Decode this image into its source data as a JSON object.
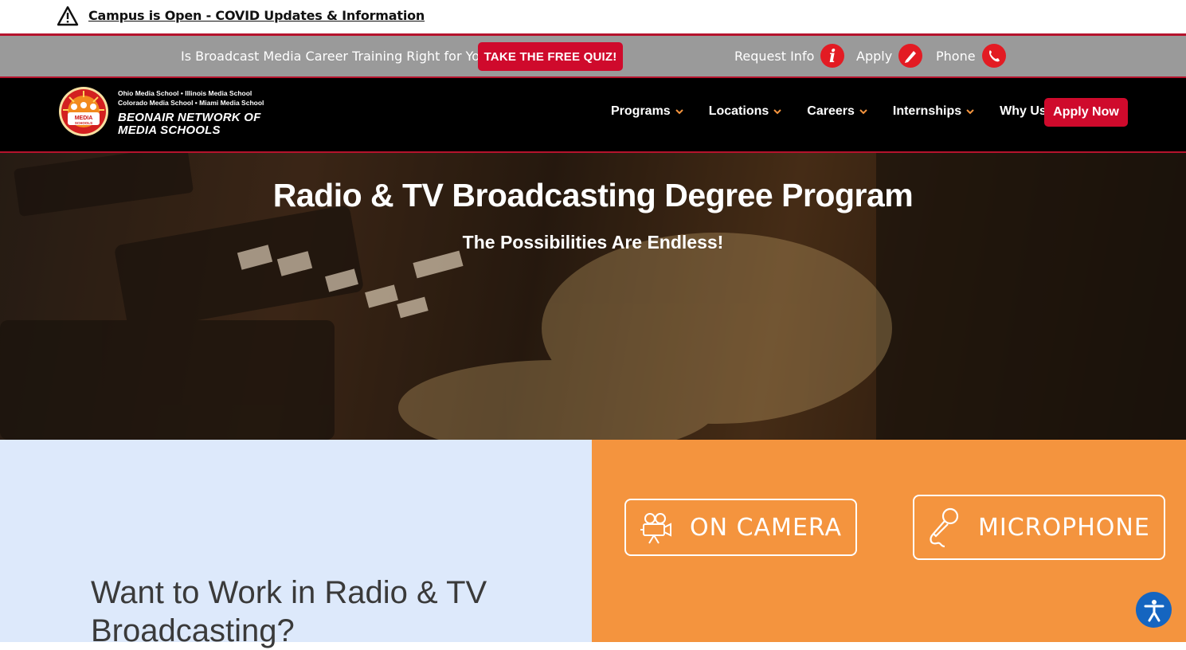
{
  "alert": {
    "text": "Campus is Open - COVID Updates & Information"
  },
  "promo": {
    "question": "Is Broadcast Media Career Training Right for You?",
    "quiz_label": "TAKE THE FREE QUIZ!",
    "request_info": "Request Info",
    "apply": "Apply",
    "phone": "Phone"
  },
  "logo": {
    "badge": "MEDIA",
    "badge_sub": "SCHOOLS",
    "line1": "Ohio Media School • Illinois Media School",
    "line2": "Colorado Media School • Miami Media School",
    "name_line1": "BEONAIR NETWORK OF",
    "name_line2": "MEDIA SCHOOLS"
  },
  "nav": {
    "items": [
      "Programs",
      "Locations",
      "Careers",
      "Internships",
      "Why Us"
    ],
    "apply_now": "Apply Now"
  },
  "hero": {
    "title": "Radio & TV Broadcasting Degree Program",
    "subtitle": "The Possibilities Are Endless!"
  },
  "main": {
    "heading": "Want to Work in Radio & TV Broadcasting?"
  },
  "categories": {
    "on_camera": "ON CAMERA",
    "microphone": "MICROPHONE"
  },
  "colors": {
    "brand_red": "#cf0a2c",
    "orange": "#f4943e",
    "light_blue": "#dde9fb"
  }
}
